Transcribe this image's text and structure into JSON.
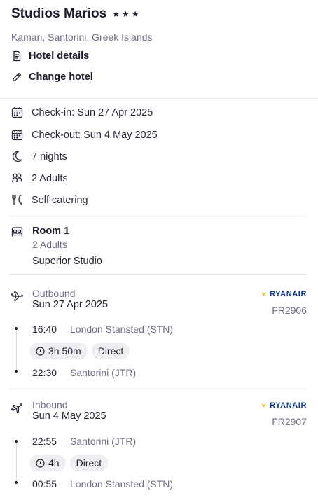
{
  "hotel": {
    "name": "Studios Marios",
    "stars": [
      "★",
      "★",
      "★"
    ],
    "location": "Kamari, Santorini, Greek Islands",
    "details_link": "Hotel details",
    "change_link": "Change hotel"
  },
  "stay": {
    "checkin": "Check-in: Sun 27 Apr 2025",
    "checkout": "Check-out: Sun 4 May 2025",
    "nights": "7 nights",
    "guests": "2 Adults",
    "board": "Self catering"
  },
  "room": {
    "name": "Room 1",
    "guests": "2 Adults",
    "type": "Superior Studio"
  },
  "outbound": {
    "label": "Outbound",
    "date": "Sun 27 Apr 2025",
    "airline": "RYANAIR",
    "code": "FR2906",
    "depart_time": "16:40",
    "depart_place": "London Stansted (STN)",
    "duration": "3h 50m",
    "stops": "Direct",
    "arrive_time": "22:30",
    "arrive_place": "Santorini (JTR)"
  },
  "inbound": {
    "label": "Inbound",
    "date": "Sun 4 May 2025",
    "airline": "RYANAIR",
    "code": "FR2907",
    "depart_time": "22:55",
    "depart_place": "Santorini (JTR)",
    "duration": "4h",
    "stops": "Direct",
    "arrive_time": "00:55",
    "arrive_place": "London Stansted (STN)"
  },
  "colors": {
    "text": "#1b1b2b",
    "muted": "#6d6e85",
    "chip": "#efeff3",
    "divider": "#e4e4ea",
    "ryanair": "#073590",
    "ryanair_harp": "#f1c933"
  }
}
